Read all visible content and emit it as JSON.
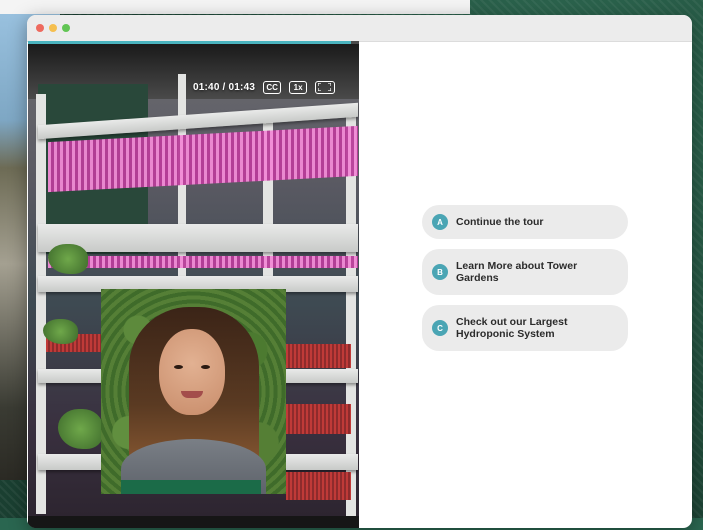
{
  "video": {
    "progress_fraction": 0.975,
    "time_display": "01:40 / 01:43",
    "captions_label": "CC",
    "speed_label": "1x",
    "fullscreen_icon": "fullscreen-icon"
  },
  "options": [
    {
      "badge": "A",
      "label": "Continue the tour"
    },
    {
      "badge": "B",
      "label": "Learn More about Tower Gardens"
    },
    {
      "badge": "C",
      "label": "Check out our Largest Hydroponic System"
    }
  ],
  "colors": {
    "accent": "#4aa5b4",
    "option_bg": "#ebebeb",
    "progress": "#4ab3be"
  }
}
